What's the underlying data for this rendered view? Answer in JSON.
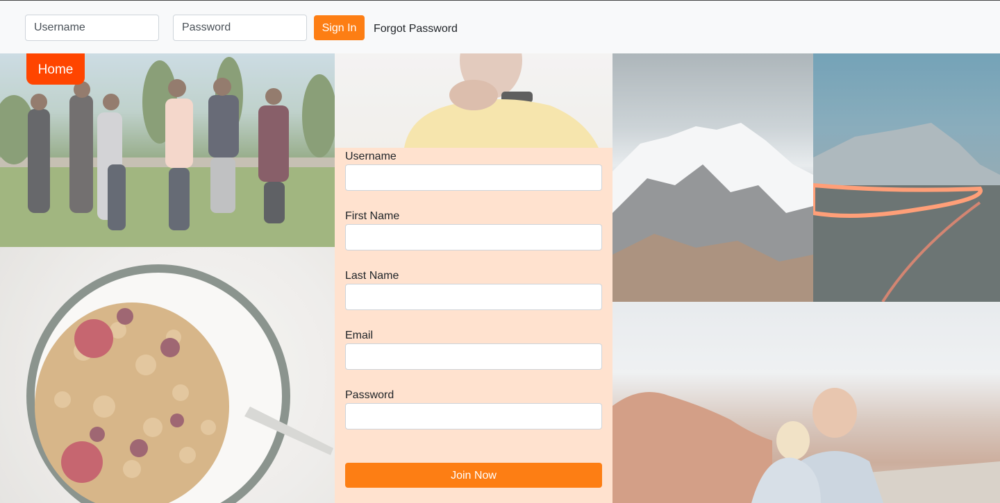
{
  "header": {
    "username_placeholder": "Username",
    "password_placeholder": "Password",
    "signin_label": "Sign In",
    "forgot_label": "Forgot Password"
  },
  "home_label": "Home",
  "signup_form": {
    "fields": [
      {
        "label": "Username"
      },
      {
        "label": "First Name"
      },
      {
        "label": "Last Name"
      },
      {
        "label": "Email"
      },
      {
        "label": "Password"
      }
    ],
    "submit_label": "Join Now"
  },
  "colors": {
    "accent": "#fd7e14",
    "home_button": "#ff4500",
    "form_background": "#ffe2cf",
    "header_background": "#f8f9fa"
  }
}
